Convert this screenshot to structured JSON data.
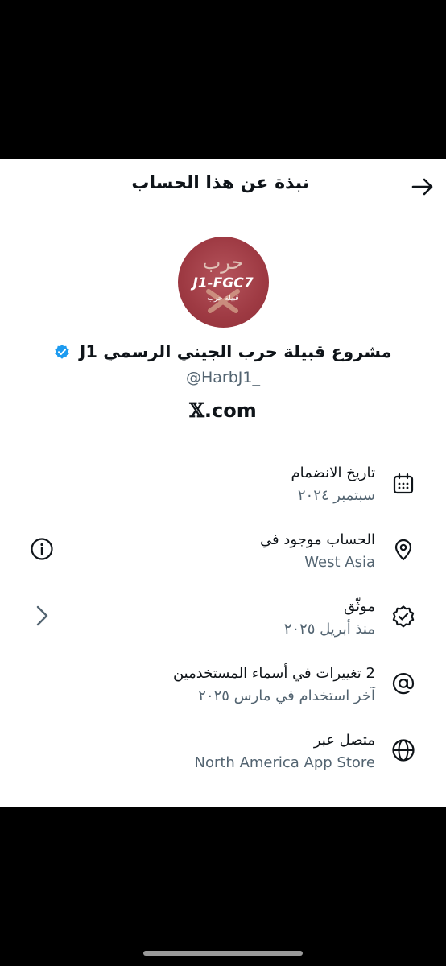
{
  "header": {
    "title": "نبذة عن هذا الحساب",
    "back_icon": "arrow-right-icon"
  },
  "profile": {
    "display_name": "مشروع قبيلة حرب الجيني الرسمي J1",
    "handle": "@HarbJ1_",
    "avatar_text_top": "حرب",
    "avatar_text_main": "J1-FGC7",
    "avatar_text_sub": "قبيلة حرب",
    "avatar_color": "#9e3a43",
    "verified_color": "#1d9bf0"
  },
  "site": {
    "logo": "𝕏",
    "domain": ".com"
  },
  "rows": [
    {
      "title": "تاريخ الانضمام",
      "subtitle": "سبتمبر ٢٠٢٤",
      "icon": "calendar-icon"
    },
    {
      "title": "الحساب موجود في",
      "subtitle": "West Asia",
      "icon": "location-pin-icon",
      "side_icon": "info-icon"
    },
    {
      "title": "موثّق",
      "subtitle": "منذ أبريل ٢٠٢٥",
      "icon": "verified-badge-icon",
      "side_icon": "chevron-right-icon"
    },
    {
      "title": "2 تغييرات في أسماء المستخدمين",
      "subtitle": "آخر استخدام في مارس ٢٠٢٥",
      "icon": "at-sign-icon"
    },
    {
      "title": "متصل عبر",
      "subtitle": "North America App Store",
      "icon": "globe-icon"
    }
  ]
}
